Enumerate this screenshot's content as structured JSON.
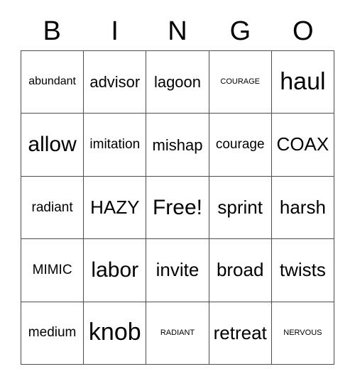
{
  "card": {
    "header": {
      "letters": [
        "B",
        "I",
        "N",
        "G",
        "O"
      ]
    },
    "rows": [
      [
        {
          "text": "abundant",
          "size": "sm"
        },
        {
          "text": "advisor",
          "size": "lg"
        },
        {
          "text": "lagoon",
          "size": "lg"
        },
        {
          "text": "COURAGE",
          "size": "xs"
        },
        {
          "text": "haul",
          "size": "huge"
        }
      ],
      [
        {
          "text": "allow",
          "size": "xxl"
        },
        {
          "text": "imitation",
          "size": "md"
        },
        {
          "text": "mishap",
          "size": "lg"
        },
        {
          "text": "courage",
          "size": "md"
        },
        {
          "text": "COAX",
          "size": "xl"
        }
      ],
      [
        {
          "text": "radiant",
          "size": "md"
        },
        {
          "text": "HAZY",
          "size": "xl"
        },
        {
          "text": "Free!",
          "size": "xxl"
        },
        {
          "text": "sprint",
          "size": "xl"
        },
        {
          "text": "harsh",
          "size": "xl"
        }
      ],
      [
        {
          "text": "MIMIC",
          "size": "md"
        },
        {
          "text": "labor",
          "size": "xxl"
        },
        {
          "text": "invite",
          "size": "xl"
        },
        {
          "text": "broad",
          "size": "xl"
        },
        {
          "text": "twists",
          "size": "xl"
        }
      ],
      [
        {
          "text": "medium",
          "size": "md"
        },
        {
          "text": "knob",
          "size": "huge"
        },
        {
          "text": "RADIANT",
          "size": "xs"
        },
        {
          "text": "retreat",
          "size": "xl"
        },
        {
          "text": "NERVOUS",
          "size": "xs"
        }
      ]
    ]
  },
  "colors": {
    "background": "#ffffff",
    "text": "#000000",
    "grid_line": "#4d4d4d"
  }
}
